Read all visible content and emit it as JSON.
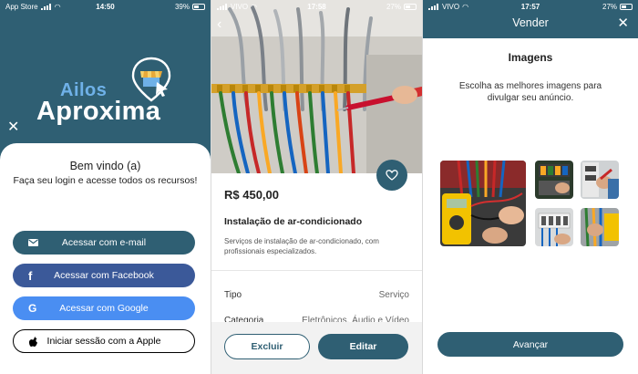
{
  "login_screen": {
    "status_bar": {
      "carrier": "App Store",
      "time": "14:50",
      "battery": "39%"
    },
    "logo": {
      "line1": "Ailos",
      "line2": "Aproxima"
    },
    "welcome_title": "Bem vindo (a)",
    "welcome_subtitle": "Faça seu login e acesse todos os recursos!",
    "buttons": {
      "email": "Acessar com e-mail",
      "facebook": "Acessar com Facebook",
      "google": "Acessar com Google",
      "apple": "Iniciar sessão com a Apple"
    },
    "colors": {
      "brand": "#2f5f73",
      "facebook": "#3b5999",
      "google": "#4a8ef2",
      "logo_accent": "#6fb1e8"
    }
  },
  "listing_screen": {
    "status_bar": {
      "carrier": "VIVO",
      "time": "17:58",
      "battery": "27%"
    },
    "price": "R$ 450,00",
    "title": "Instalação de ar-condicionado",
    "description": "Serviços de instalação de ar-condicionado, com profissionais especializados.",
    "details": [
      {
        "label": "Tipo",
        "value": "Serviço"
      },
      {
        "label": "Categoria",
        "value": "Eletrônicos, Áudio e Vídeo"
      }
    ],
    "delete_label": "Excluir",
    "edit_label": "Editar"
  },
  "sell_screen": {
    "status_bar": {
      "carrier": "VIVO",
      "time": "17:57",
      "battery": "27%"
    },
    "header_title": "Vender",
    "section_title": "Imagens",
    "instructions": "Escolha as melhores imagens para divulgar seu anúncio.",
    "next_label": "Avançar"
  }
}
